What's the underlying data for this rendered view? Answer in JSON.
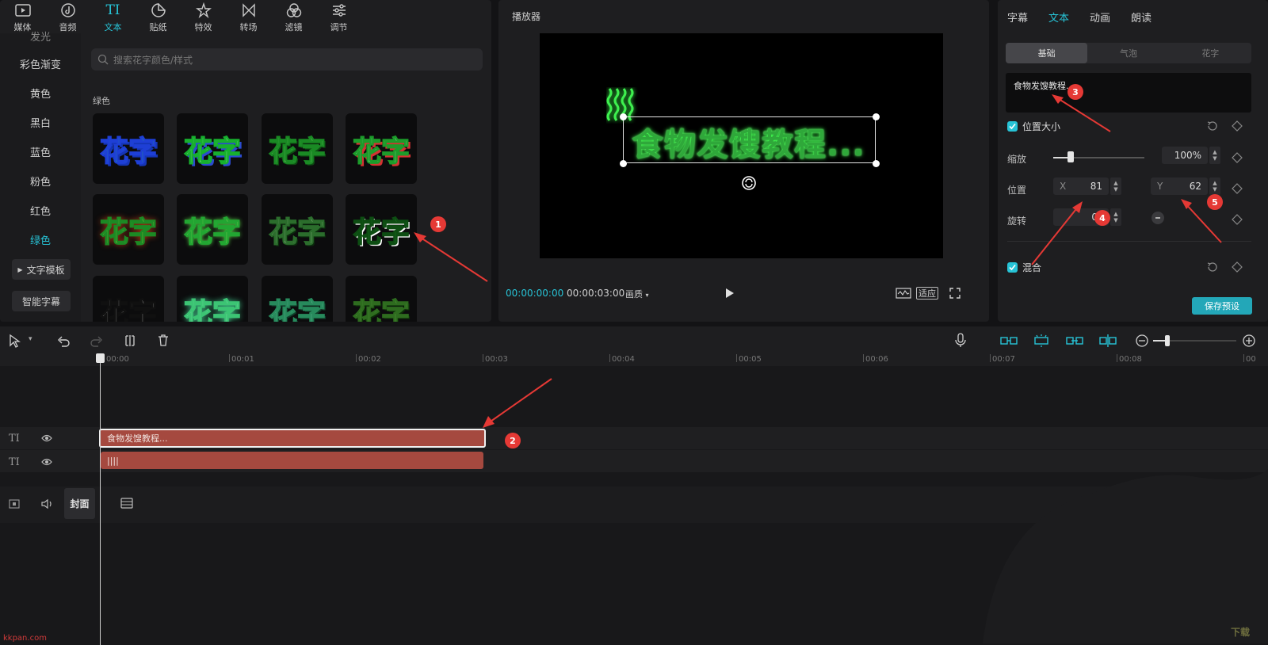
{
  "tabs": [
    {
      "label": "媒体",
      "icon": "media-icon"
    },
    {
      "label": "音频",
      "icon": "audio-icon"
    },
    {
      "label": "文本",
      "icon": "text-icon",
      "active": true
    },
    {
      "label": "贴纸",
      "icon": "sticker-icon"
    },
    {
      "label": "特效",
      "icon": "effects-icon"
    },
    {
      "label": "转场",
      "icon": "transition-icon"
    },
    {
      "label": "滤镜",
      "icon": "filter-icon"
    },
    {
      "label": "调节",
      "icon": "adjust-icon"
    }
  ],
  "categories": {
    "partial_top": "发光",
    "items": [
      "彩色渐变",
      "黄色",
      "黑白",
      "蓝色",
      "粉色",
      "红色",
      "绿色"
    ],
    "active": "绿色",
    "template_btn": "文字模板",
    "smart_caption_btn": "智能字幕"
  },
  "search": {
    "placeholder": "搜索花字颜色/样式"
  },
  "section_label": "绿色",
  "tile_text": "花字",
  "player": {
    "title": "播放器",
    "canvas_text": "食物发馊教程...",
    "time_current": "00:00:00:00",
    "time_total": "00:00:03:00",
    "quality": "画质",
    "fit": "适应"
  },
  "right": {
    "tabs": [
      "字幕",
      "文本",
      "动画",
      "朗读"
    ],
    "active_tab": "文本",
    "segments": [
      "基础",
      "气泡",
      "花字"
    ],
    "text_value": "食物发馊教程...",
    "section_position": "位置大小",
    "scale_label": "缩放",
    "scale_value": "100%",
    "position_label": "位置",
    "x_prefix": "X",
    "x_value": "81",
    "y_prefix": "Y",
    "y_value": "62",
    "rotation_label": "旋转",
    "rotation_value": "0°",
    "section_blend": "混合",
    "save_btn": "保存预设"
  },
  "timeline": {
    "ticks": [
      "00:00",
      "00:01",
      "00:02",
      "00:03",
      "00:04",
      "00:05",
      "00:06",
      "00:07",
      "00:08",
      "00"
    ],
    "clip1_label": "食物发馊教程...",
    "clip2_label": "||||",
    "cover": "封面"
  },
  "badges": [
    "1",
    "2",
    "3",
    "4",
    "5"
  ],
  "watermark_left": "kkpan.com",
  "watermark_right": "下载"
}
